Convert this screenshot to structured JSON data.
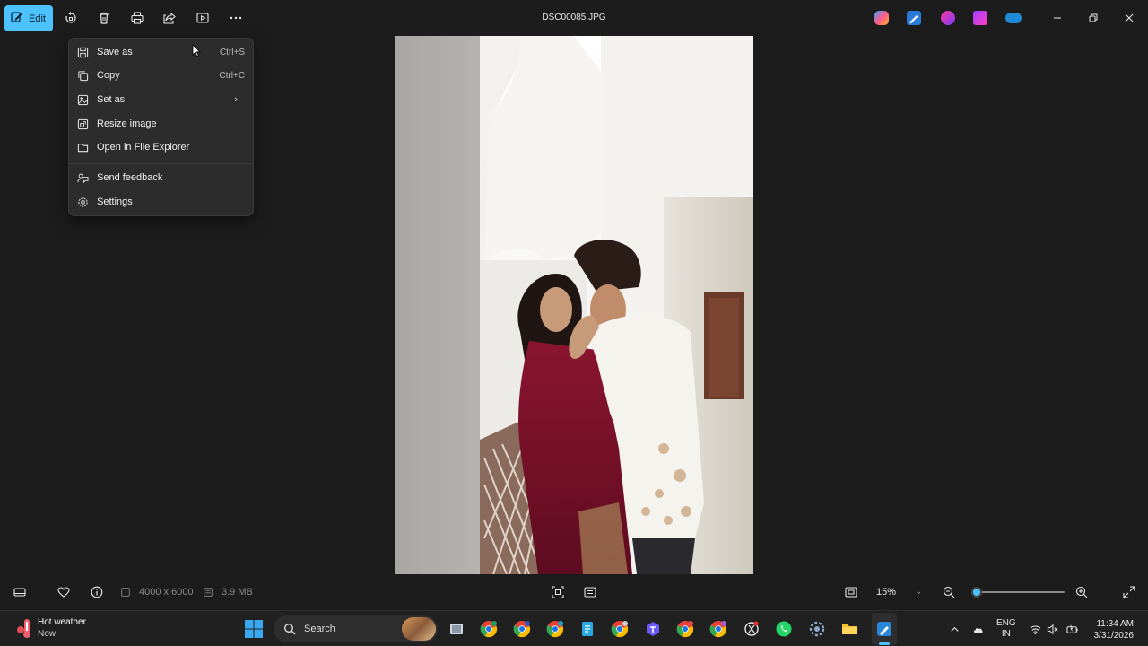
{
  "toolbar": {
    "edit_label": "Edit",
    "file_name": "DSC00085.JPG"
  },
  "context_menu": {
    "items": [
      {
        "label": "Save as",
        "shortcut": "Ctrl+S"
      },
      {
        "label": "Copy",
        "shortcut": "Ctrl+C"
      },
      {
        "label": "Set as",
        "shortcut": ""
      },
      {
        "label": "Resize image",
        "shortcut": ""
      },
      {
        "label": "Open in File Explorer",
        "shortcut": ""
      },
      {
        "label": "Send feedback",
        "shortcut": ""
      },
      {
        "label": "Settings",
        "shortcut": ""
      }
    ]
  },
  "info_bar": {
    "dimensions": "4000 x 6000",
    "file_size": "3.9 MB",
    "zoom_level": "15%",
    "zoom_slider_fraction": 0.15
  },
  "taskbar": {
    "weather_title": "Hot weather",
    "weather_sub": "Now",
    "search_placeholder": "Search",
    "lang_line1": "ENG",
    "lang_line2": "IN",
    "time": "11:34 AM",
    "date": "3/31/2026"
  },
  "colors": {
    "accent": "#4cc2ff",
    "background": "#1c1c1c",
    "menu_bg": "#2c2c2c",
    "taskbar_bg": "#202020"
  }
}
